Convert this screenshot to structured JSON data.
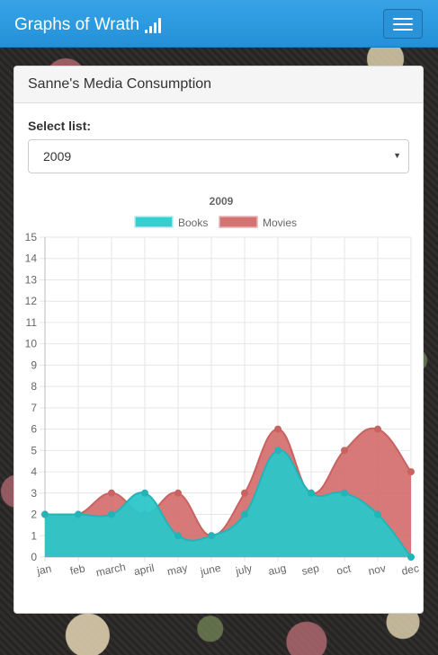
{
  "navbar": {
    "brand": "Graphs of Wrath",
    "brand_icon": "signal-bars-icon",
    "menu_icon": "hamburger-menu-icon"
  },
  "panel": {
    "title": "Sanne's Media Consumption",
    "select_label": "Select list:",
    "selected_option": "2009"
  },
  "colors": {
    "navbar": "#2b99df",
    "books_fill": "#2cc6c9",
    "books_legend": "#33d0d2",
    "movies_fill": "#d36e6c",
    "movies_legend": "#d47472"
  },
  "chart_data": {
    "type": "area",
    "title": "2009",
    "categories": [
      "jan",
      "feb",
      "march",
      "april",
      "may",
      "june",
      "july",
      "aug",
      "sep",
      "oct",
      "nov",
      "dec"
    ],
    "series": [
      {
        "name": "Books",
        "values": [
          2,
          2,
          2,
          3,
          1,
          1,
          2,
          5,
          3,
          3,
          2,
          0
        ]
      },
      {
        "name": "Movies",
        "values": [
          2,
          2,
          3,
          2,
          3,
          1,
          3,
          6,
          3,
          5,
          6,
          4
        ]
      }
    ],
    "ylim": [
      0,
      15
    ],
    "yticks": [
      0,
      1,
      2,
      3,
      4,
      5,
      6,
      7,
      8,
      9,
      10,
      11,
      12,
      13,
      14,
      15
    ],
    "grid": true,
    "legend": "top"
  }
}
